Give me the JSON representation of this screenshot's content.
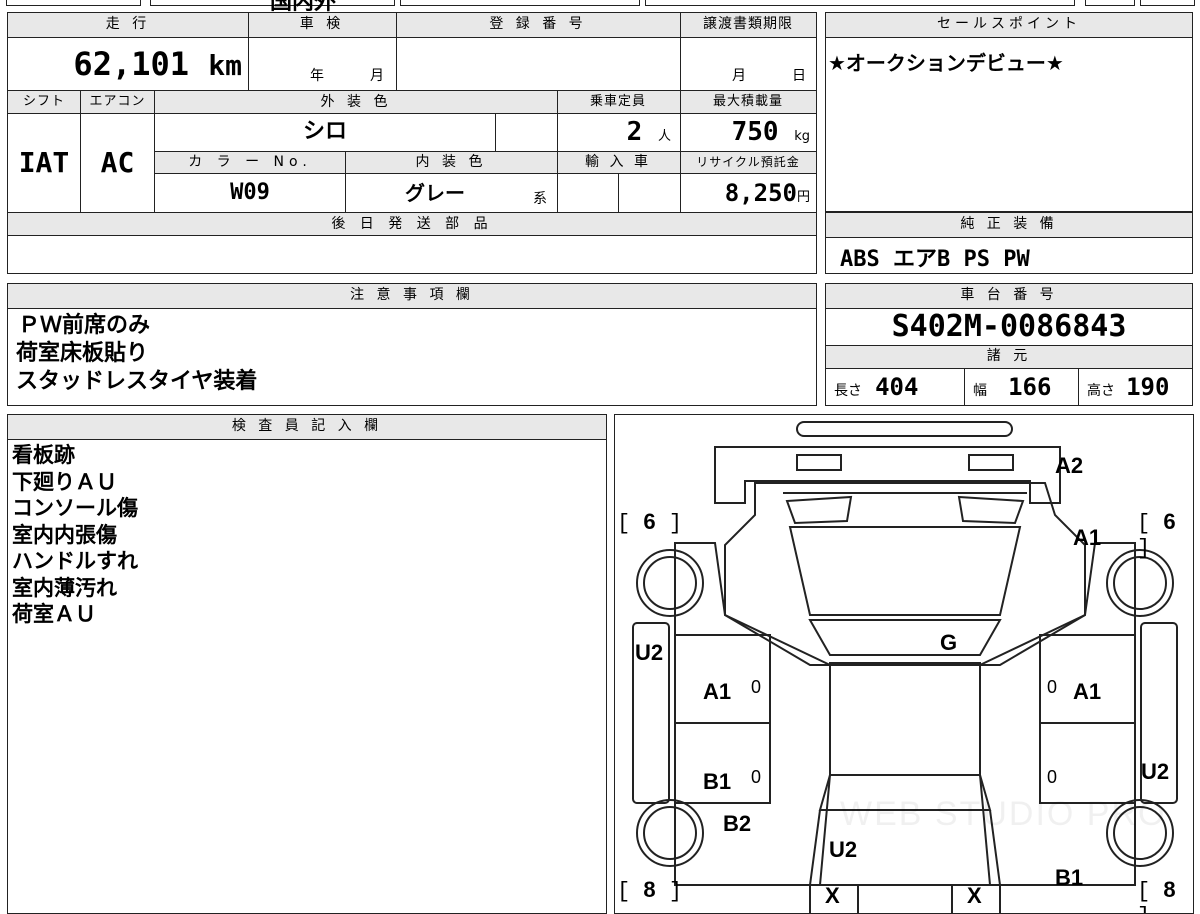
{
  "top_strip": {
    "partial_a": "",
    "partial_b": "国内外"
  },
  "vehicle": {
    "headers": {
      "mileage": "走 行",
      "inspection": "車 検",
      "registration": "登 録 番 号",
      "transfer_deadline": "譲渡書類期限",
      "shift": "シフト",
      "aircon": "エアコン",
      "exterior_color": "外 装 色",
      "capacity": "乗車定員",
      "max_load": "最大積載量",
      "color_no": "カ ラ ー No.",
      "interior_color": "内 装 色",
      "import": "輸 入 車",
      "recycle_fee": "リサイクル預託金",
      "later_parts": "後 日 発 送 部 品"
    },
    "mileage": "62,101",
    "mileage_unit": "km",
    "inspection_year_unit": "年",
    "inspection_month_unit": "月",
    "deadline_month_unit": "月",
    "deadline_day_unit": "日",
    "shift": "IAT",
    "aircon": "AC",
    "exterior_color": "シロ",
    "capacity": "2",
    "capacity_unit": "人",
    "max_load": "750",
    "max_load_unit": "kg",
    "color_no": "W09",
    "interior_color": "グレー",
    "interior_suffix": "系",
    "recycle_fee": "8,250",
    "recycle_unit": "円"
  },
  "sales_point": {
    "header": "セールスポイント",
    "text": "★オークションデビュー★"
  },
  "genuine_equipment": {
    "header": "純 正 装 備",
    "text": "ABS エアB PS PW"
  },
  "notes": {
    "header": "注 意 事 項 欄",
    "lines": [
      "ＰＷ前席のみ",
      "荷室床板貼り",
      "スタッドレスタイヤ装着"
    ]
  },
  "chassis": {
    "header": "車 台 番 号",
    "number": "S402M-0086843"
  },
  "specs": {
    "header": "諸 元",
    "length_label": "長さ",
    "length": "404",
    "width_label": "幅",
    "width": "166",
    "height_label": "高さ",
    "height": "190"
  },
  "inspector": {
    "header": "検 査 員 記 入 欄",
    "lines": [
      "看板跡",
      "下廻りＡＵ",
      "コンソール傷",
      "室内内張傷",
      "ハンドルすれ",
      "室内薄汚れ",
      "荷室ＡＵ"
    ]
  },
  "diagram": {
    "marks": {
      "front_bumper": "A2",
      "front_right": "A1",
      "hood": "G",
      "left_side": "U2",
      "left_front_door": "A1",
      "right_front_door": "A1",
      "left_rear_door": "B1",
      "right_side": "U2",
      "left_rear": "B2",
      "rear_floor": "U2",
      "right_rear": "B1",
      "rear_left_x": "X",
      "rear_right_x": "X",
      "door_zero": "0"
    },
    "tires": {
      "front_left": "6",
      "front_right": "6",
      "rear_left": "8",
      "rear_right": "8"
    },
    "watermark": "WEB STUDIO PRO"
  }
}
